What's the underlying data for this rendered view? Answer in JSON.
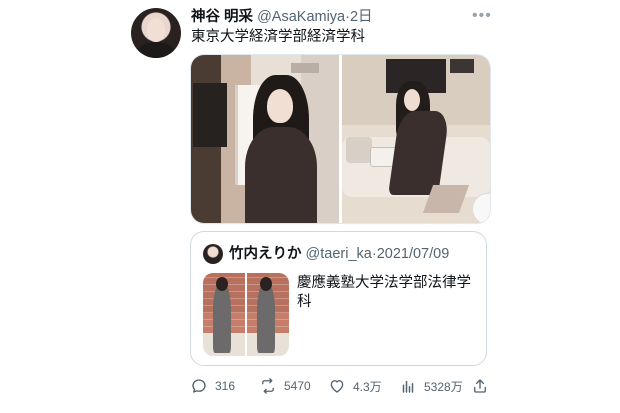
{
  "author": {
    "name": "神谷 明采",
    "handle": "@AsaKamiya",
    "separator": "·",
    "time": "2日"
  },
  "tweet": {
    "text": "東京大学経済学部経済学科",
    "more_icon": "ellipsis-icon"
  },
  "quoted": {
    "name": "竹内えりか",
    "handle": "@taeri_ka",
    "separator": "·",
    "date": "2021/07/09",
    "text": "慶應義塾大学法学部法律学科"
  },
  "actions": {
    "replies": "316",
    "retweets": "5470",
    "likes": "4.3万",
    "views": "5328万"
  },
  "colors": {
    "text": "#0f1419",
    "muted": "#536471",
    "border": "#cfd9de"
  }
}
